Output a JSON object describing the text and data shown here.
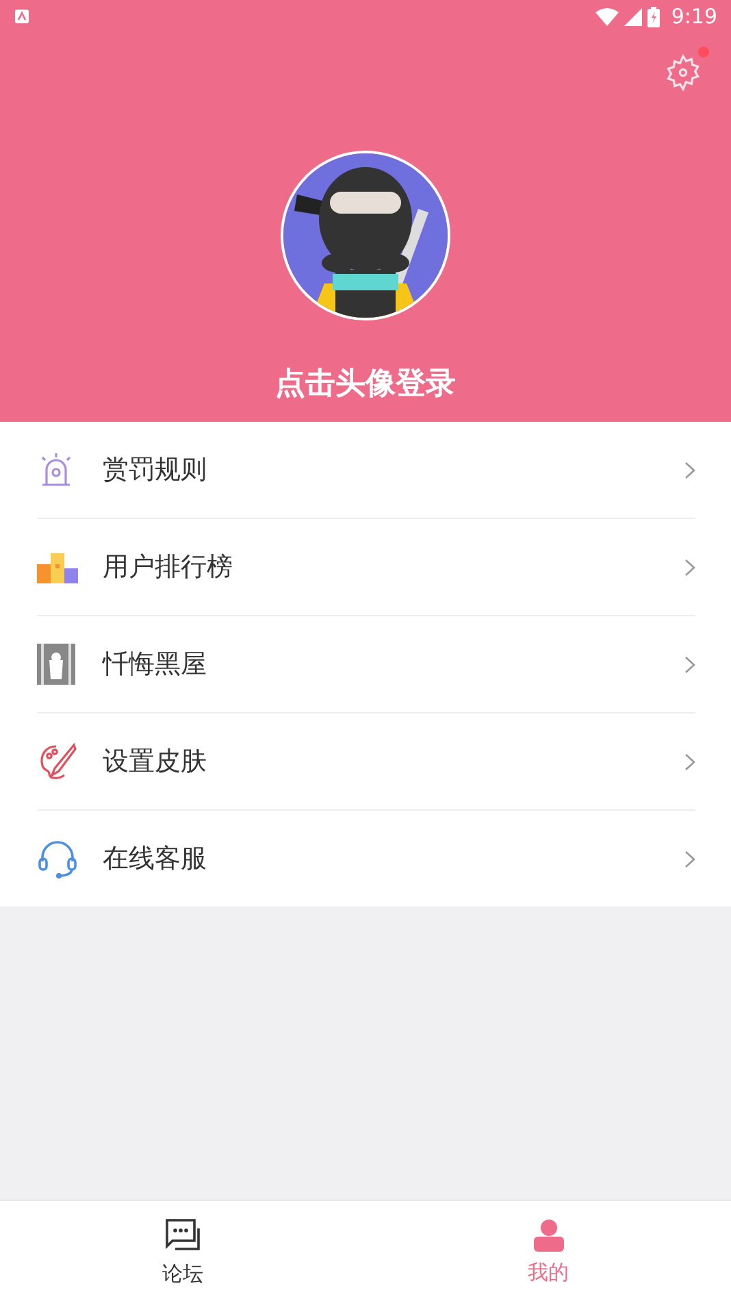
{
  "status_bar": {
    "time": "9:19"
  },
  "header": {
    "settings_dot": true,
    "login_text": "点击头像登录"
  },
  "menu": [
    {
      "label": "赏罚规则"
    },
    {
      "label": "用户排行榜"
    },
    {
      "label": "忏悔黑屋"
    },
    {
      "label": "设置皮肤"
    },
    {
      "label": "在线客服"
    }
  ],
  "tab_bar": [
    {
      "label": "论坛",
      "selected": false
    },
    {
      "label": "我的",
      "selected": true
    }
  ]
}
